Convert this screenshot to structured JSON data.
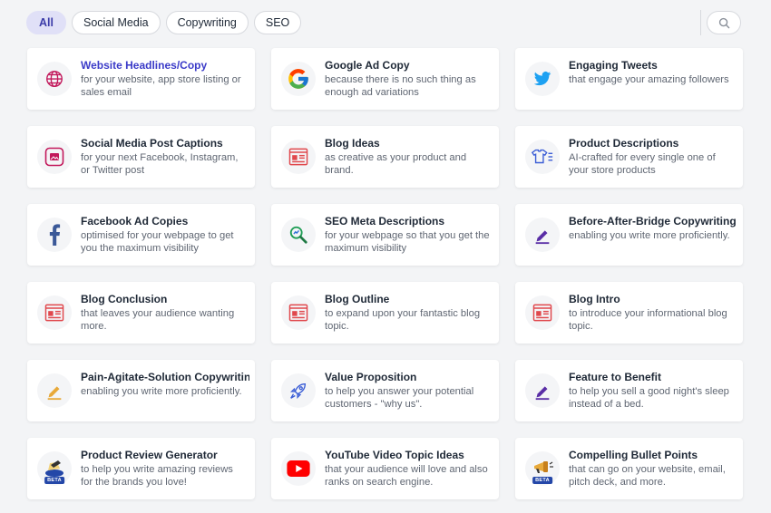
{
  "filters": {
    "items": [
      {
        "label": "All",
        "active": true
      },
      {
        "label": "Social Media",
        "active": false
      },
      {
        "label": "Copywriting",
        "active": false
      },
      {
        "label": "SEO",
        "active": false
      }
    ]
  },
  "search": {
    "icon": "search-icon"
  },
  "cards": [
    {
      "title": "Website Headlines/Copy",
      "desc": "for your website, app store listing or sales email",
      "icon": "globe-icon"
    },
    {
      "title": "Google Ad Copy",
      "desc": "because there is no such thing as enough ad variations",
      "icon": "google-icon"
    },
    {
      "title": "Engaging Tweets",
      "desc": "that engage your amazing followers",
      "icon": "twitter-icon"
    },
    {
      "title": "Social Media Post Captions",
      "desc": "for your next Facebook, Instagram, or Twitter post",
      "icon": "image-icon"
    },
    {
      "title": "Blog Ideas",
      "desc": "as creative as your product and brand.",
      "icon": "article-icon"
    },
    {
      "title": "Product Descriptions",
      "desc": "AI-crafted for every single one of your store products",
      "icon": "shirt-list-icon"
    },
    {
      "title": "Facebook Ad Copies",
      "desc": "optimised for your webpage to get you the maximum visibility",
      "icon": "facebook-icon"
    },
    {
      "title": "SEO Meta Descriptions",
      "desc": "for your webpage so that you get the maximum visibility",
      "icon": "magnifier-seo-icon"
    },
    {
      "title": "Before-After-Bridge Copywriting",
      "desc": "enabling you write more proficiently.",
      "icon": "pen-icon"
    },
    {
      "title": "Blog Conclusion",
      "desc": "that leaves your audience wanting more.",
      "icon": "article-icon"
    },
    {
      "title": "Blog Outline",
      "desc": "to expand upon your fantastic blog topic.",
      "icon": "article-icon"
    },
    {
      "title": "Blog Intro",
      "desc": "to introduce your informational blog topic.",
      "icon": "article-icon"
    },
    {
      "title": "Pain-Agitate-Solution Copywriting",
      "desc": "enabling you write more proficiently.",
      "icon": "pen-icon"
    },
    {
      "title": "Value Proposition",
      "desc": "to help you answer your potential customers - \"why us\".",
      "icon": "rocket-icon"
    },
    {
      "title": "Feature to Benefit",
      "desc": "to help you sell a good night's sleep instead of a bed.",
      "icon": "pen-icon"
    },
    {
      "title": "Product Review Generator",
      "desc": "to help you write amazing reviews for the brands you love!",
      "icon": "review-writing-icon",
      "badge": "BETA"
    },
    {
      "title": "YouTube Video Topic Ideas",
      "desc": "that your audience will love and also ranks on search engine.",
      "icon": "youtube-icon"
    },
    {
      "title": "Compelling Bullet Points",
      "desc": "that can go on your website, email, pitch deck, and more.",
      "icon": "megaphone-icon",
      "badge": "BETA"
    }
  ],
  "colors": {
    "accent": "#3b3bc8",
    "active_pill_bg": "#e0e0f7",
    "icon_red": "#e0474c",
    "icon_blue": "#3d5fd6",
    "icon_purple": "#5a2ea6",
    "icon_amber": "#e8a93a",
    "twitter": "#1da1f2",
    "facebook": "#3b5998",
    "youtube": "#ff0000"
  }
}
